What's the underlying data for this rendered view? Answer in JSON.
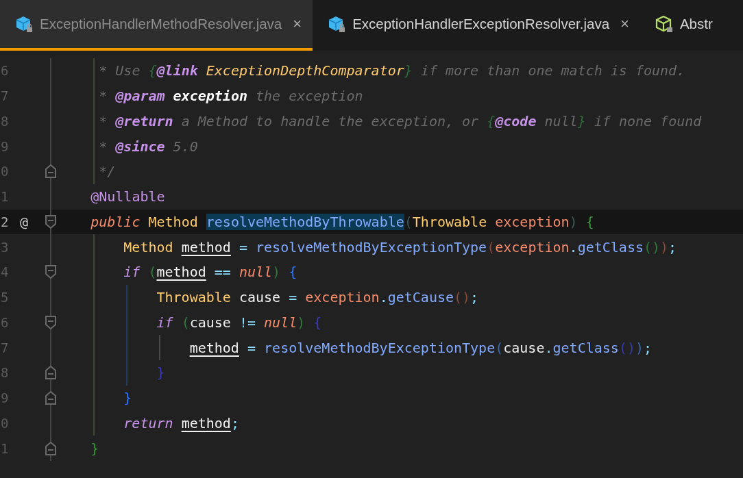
{
  "tabs": [
    {
      "label": "ExceptionHandlerMethodResolver.java",
      "kind": "class",
      "close": "×",
      "selected": true
    },
    {
      "label": "ExceptionHandlerExceptionResolver.java",
      "kind": "class",
      "close": "×",
      "selected": false
    },
    {
      "label": "Abstr",
      "kind": "abstract",
      "selected": false
    }
  ],
  "editor": {
    "lines": [
      {
        "number": "6",
        "current": false,
        "fold_start": false,
        "fold_end": false,
        "tokens": [
          {
            "text": "     * Use ",
            "kind": "comment"
          },
          {
            "text": "{",
            "kind": "docbrace"
          },
          {
            "text": "@link",
            "kind": "doctag"
          },
          {
            "text": " ExceptionDepthComparator",
            "kind": "docref"
          },
          {
            "text": "}",
            "kind": "docbrace"
          },
          {
            "text": " if more than one match is found.",
            "kind": "comment"
          }
        ]
      },
      {
        "number": "7",
        "current": false,
        "fold_start": false,
        "fold_end": false,
        "tokens": [
          {
            "text": "     * ",
            "kind": "comment"
          },
          {
            "text": "@param",
            "kind": "doctag"
          },
          {
            "text": " exception",
            "kind": "docparam"
          },
          {
            "text": " the exception",
            "kind": "comment"
          }
        ]
      },
      {
        "number": "8",
        "current": false,
        "fold_start": false,
        "fold_end": false,
        "tokens": [
          {
            "text": "     * ",
            "kind": "comment"
          },
          {
            "text": "@return",
            "kind": "doctag"
          },
          {
            "text": " a Method to handle the exception, or ",
            "kind": "comment"
          },
          {
            "text": "{",
            "kind": "docbrace"
          },
          {
            "text": "@code",
            "kind": "doctag"
          },
          {
            "text": " null",
            "kind": "comment"
          },
          {
            "text": "}",
            "kind": "docbrace"
          },
          {
            "text": " if none found",
            "kind": "comment"
          }
        ]
      },
      {
        "number": "9",
        "current": false,
        "fold_start": false,
        "fold_end": false,
        "tokens": [
          {
            "text": "     * ",
            "kind": "comment"
          },
          {
            "text": "@since",
            "kind": "doctag"
          },
          {
            "text": " 5.0",
            "kind": "comment"
          }
        ]
      },
      {
        "number": "0",
        "current": false,
        "fold_start": false,
        "fold_end": true,
        "tokens": [
          {
            "text": "     */",
            "kind": "comment"
          }
        ]
      },
      {
        "number": "1",
        "current": false,
        "fold_start": false,
        "fold_end": false,
        "tokens": [
          {
            "text": "    @Nullable",
            "kind": "annotation"
          }
        ]
      },
      {
        "number": "2",
        "current": true,
        "marker": "@",
        "fold_start": true,
        "fold_end": false,
        "tokens": [
          {
            "text": "    public",
            "kind": "modifier"
          },
          {
            "text": " Method ",
            "kind": "type"
          },
          {
            "text": "resolveMethodByThrowable",
            "kind": "func",
            "highlighted": true
          },
          {
            "text": "(",
            "kind": "paren-dim"
          },
          {
            "text": "Throwable",
            "kind": "type"
          },
          {
            "text": " exception",
            "kind": "param"
          },
          {
            "text": ")",
            "kind": "paren-dim"
          },
          {
            "text": " {",
            "kind": "brace-green"
          }
        ]
      },
      {
        "number": "3",
        "current": false,
        "fold_start": false,
        "fold_end": false,
        "tokens": [
          {
            "text": "        Method ",
            "kind": "type"
          },
          {
            "text": "method",
            "kind": "local"
          },
          {
            "text": " = ",
            "kind": "op"
          },
          {
            "text": "resolveMethodByExceptionType",
            "kind": "func"
          },
          {
            "text": "(",
            "kind": "paren-orange"
          },
          {
            "text": "exception",
            "kind": "param"
          },
          {
            "text": ".",
            "kind": "op"
          },
          {
            "text": "getClass",
            "kind": "func"
          },
          {
            "text": "()",
            "kind": "paren-green"
          },
          {
            "text": ")",
            "kind": "paren-orange"
          },
          {
            "text": ";",
            "kind": "op"
          }
        ]
      },
      {
        "number": "4",
        "current": false,
        "fold_start": true,
        "fold_end": false,
        "tokens": [
          {
            "text": "        if ",
            "kind": "keyword"
          },
          {
            "text": "(",
            "kind": "paren-green"
          },
          {
            "text": "method",
            "kind": "local"
          },
          {
            "text": " == ",
            "kind": "op"
          },
          {
            "text": "null",
            "kind": "literal"
          },
          {
            "text": ")",
            "kind": "paren-green"
          },
          {
            "text": " {",
            "kind": "brace-blue"
          }
        ]
      },
      {
        "number": "5",
        "current": false,
        "fold_start": false,
        "fold_end": false,
        "tokens": [
          {
            "text": "            Throwable",
            "kind": "type"
          },
          {
            "text": " cause ",
            "kind": "plain"
          },
          {
            "text": "= ",
            "kind": "op"
          },
          {
            "text": "exception",
            "kind": "param"
          },
          {
            "text": ".",
            "kind": "op"
          },
          {
            "text": "getCause",
            "kind": "func"
          },
          {
            "text": "()",
            "kind": "paren-orange"
          },
          {
            "text": ";",
            "kind": "op"
          }
        ]
      },
      {
        "number": "6",
        "current": false,
        "fold_start": true,
        "fold_end": false,
        "tokens": [
          {
            "text": "            if ",
            "kind": "keyword"
          },
          {
            "text": "(",
            "kind": "paren-green"
          },
          {
            "text": "cause ",
            "kind": "plain"
          },
          {
            "text": "!= ",
            "kind": "op"
          },
          {
            "text": "null",
            "kind": "literal"
          },
          {
            "text": ")",
            "kind": "paren-green"
          },
          {
            "text": " {",
            "kind": "brace-indigo"
          }
        ]
      },
      {
        "number": "7",
        "current": false,
        "fold_start": false,
        "fold_end": false,
        "tokens": [
          {
            "text": "                method",
            "kind": "local"
          },
          {
            "text": " = ",
            "kind": "op"
          },
          {
            "text": "resolveMethodByExceptionType",
            "kind": "func"
          },
          {
            "text": "(",
            "kind": "paren-blue"
          },
          {
            "text": "cause",
            "kind": "plain"
          },
          {
            "text": ".",
            "kind": "op"
          },
          {
            "text": "getClass",
            "kind": "func"
          },
          {
            "text": "()",
            "kind": "paren-indigo"
          },
          {
            "text": ")",
            "kind": "paren-blue"
          },
          {
            "text": ";",
            "kind": "op"
          }
        ]
      },
      {
        "number": "8",
        "current": false,
        "fold_start": false,
        "fold_end": true,
        "tokens": [
          {
            "text": "            }",
            "kind": "brace-indigo"
          }
        ]
      },
      {
        "number": "9",
        "current": false,
        "fold_start": false,
        "fold_end": true,
        "tokens": [
          {
            "text": "        }",
            "kind": "brace-blue"
          }
        ]
      },
      {
        "number": "0",
        "current": false,
        "fold_start": false,
        "fold_end": false,
        "tokens": [
          {
            "text": "        return ",
            "kind": "keyword"
          },
          {
            "text": "method",
            "kind": "local"
          },
          {
            "text": ";",
            "kind": "op"
          }
        ]
      },
      {
        "number": "1",
        "current": false,
        "fold_start": false,
        "fold_end": true,
        "tokens": [
          {
            "text": "    }",
            "kind": "brace-green"
          }
        ]
      }
    ]
  }
}
